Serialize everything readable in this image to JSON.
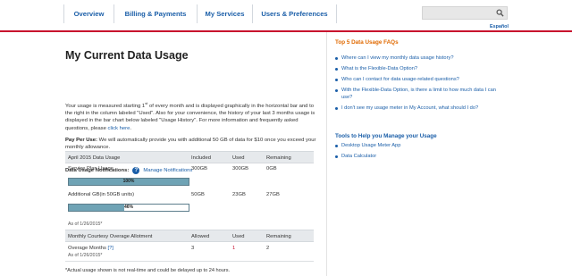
{
  "nav": {
    "items": [
      "Overview",
      "Billing & Payments",
      "My Services",
      "Users & Preferences"
    ],
    "language_link": "Español"
  },
  "search": {
    "placeholder": "",
    "icon": "search-icon"
  },
  "main": {
    "title": "My Current Data Usage",
    "intro_p1": "Your usage is measured starting 1",
    "intro_sup": "st",
    "intro_p2": " of every month and is displayed graphically in the horizontal bar and to the right in the column labeled \"Used\". Also for your convenience, the history of your last 3 months usage is displayed in the bar chart below labeled \"Usage History\". For more information and frequently asked questions, please ",
    "intro_link": "click here",
    "intro_end": ".",
    "ppu_label": "Pay Per Use:",
    "ppu_text": " We will automatically provide you with additional 50 GB of data for $10 once you exceed your monthly allowance.",
    "plan_label": "My Current Service Plan:",
    "plan_value": " PERFORMANCE",
    "notif_label": "Data Usage Notifications:",
    "notif_link": "Manage Notifications",
    "usage_table": {
      "headers": [
        "April 2015 Data Usage",
        "Included",
        "Used",
        "Remaining"
      ],
      "rows": [
        {
          "name": "Service Plan Usage",
          "included": "300GB",
          "used": "300GB",
          "remaining": "0GB",
          "bar_label": "100%",
          "bar_pct": 100
        },
        {
          "name": "Additional GB(in 50GB units)",
          "included": "50GB",
          "used": "23GB",
          "remaining": "27GB",
          "bar_label": "46%",
          "bar_pct": 46
        }
      ],
      "as_of": "As of 1/26/2015*"
    },
    "overage_table": {
      "headers": [
        "Monthly Courtesy Overage Allotment",
        "Allowed",
        "Used",
        "Remaining"
      ],
      "row": {
        "name": "Overage Months ",
        "help": "[?]",
        "allowed": "3",
        "used": "1",
        "remaining": "2"
      },
      "as_of": "As of 1/26/2015*"
    },
    "footnote": "*Actual usage shown is not real-time and could be delayed up to 24 hours."
  },
  "sidebar": {
    "faq_title": "Top 5 Data Usage FAQs",
    "faqs": [
      "Where can I view my monthly data usage history?",
      "What is the Flexible-Data Option?",
      "Who can I contact for data usage-related questions?",
      "With the Flexible-Data Option, is there a limit to how much data I can use?",
      "I don't see my usage meter in My Account, what should I do?"
    ],
    "tools_title": "Tools to Help you Manage your Usage",
    "tools": [
      "Desktop Usage Meter App",
      "Data Calculator"
    ]
  },
  "colors": {
    "brand_red": "#c8102e",
    "link_blue": "#1a5ea8",
    "faq_orange": "#e06900",
    "bar_fill": "#6fa3b5"
  }
}
